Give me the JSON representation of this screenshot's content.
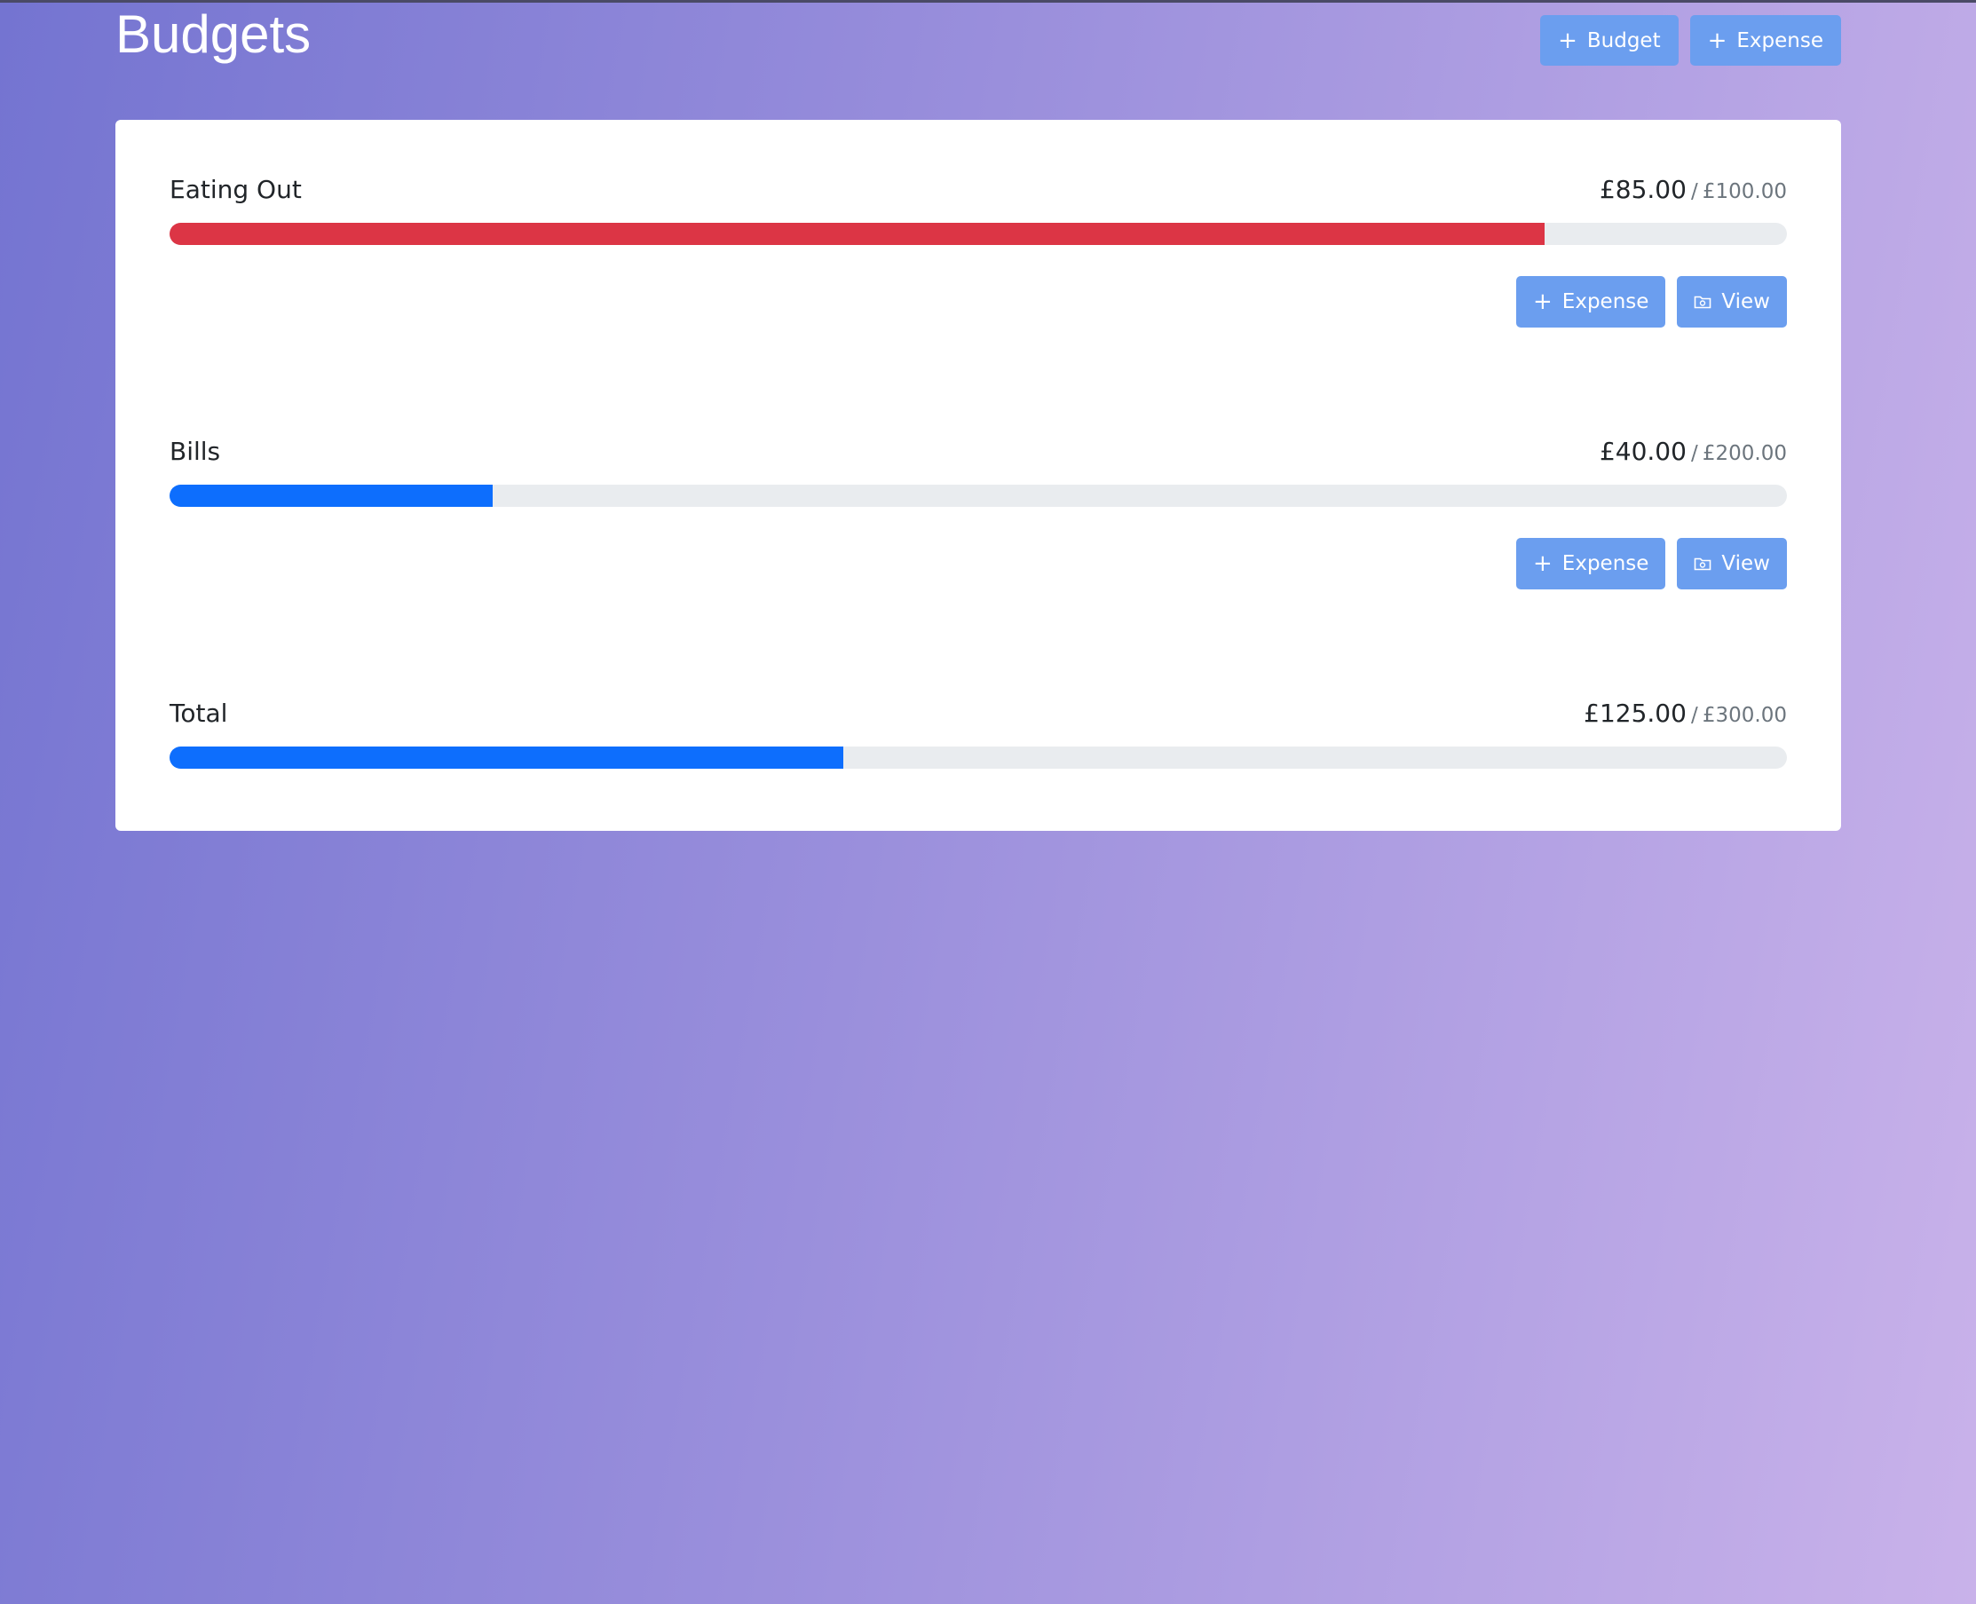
{
  "header": {
    "title": "Budgets",
    "add_budget_label": "Budget",
    "add_expense_label": "Expense",
    "plus_glyph": "+"
  },
  "colors": {
    "button": "#6b9eef",
    "bar_over": "#dc3545",
    "bar_normal": "#0d6efd",
    "track": "#e9ecef"
  },
  "budgets": [
    {
      "name": "Eating Out",
      "spent": "£85.00",
      "separator": "/",
      "total": "£100.00",
      "fraction": 0.85,
      "bar_color": "#dc3545",
      "expense_label": "Expense",
      "view_label": "View"
    },
    {
      "name": "Bills",
      "spent": "£40.00",
      "separator": "/",
      "total": "£200.00",
      "fraction": 0.2,
      "bar_color": "#0d6efd",
      "expense_label": "Expense",
      "view_label": "View"
    }
  ],
  "total": {
    "name": "Total",
    "spent": "£125.00",
    "separator": "/",
    "total": "£300.00",
    "fraction": 0.4167,
    "bar_color": "#0d6efd"
  }
}
